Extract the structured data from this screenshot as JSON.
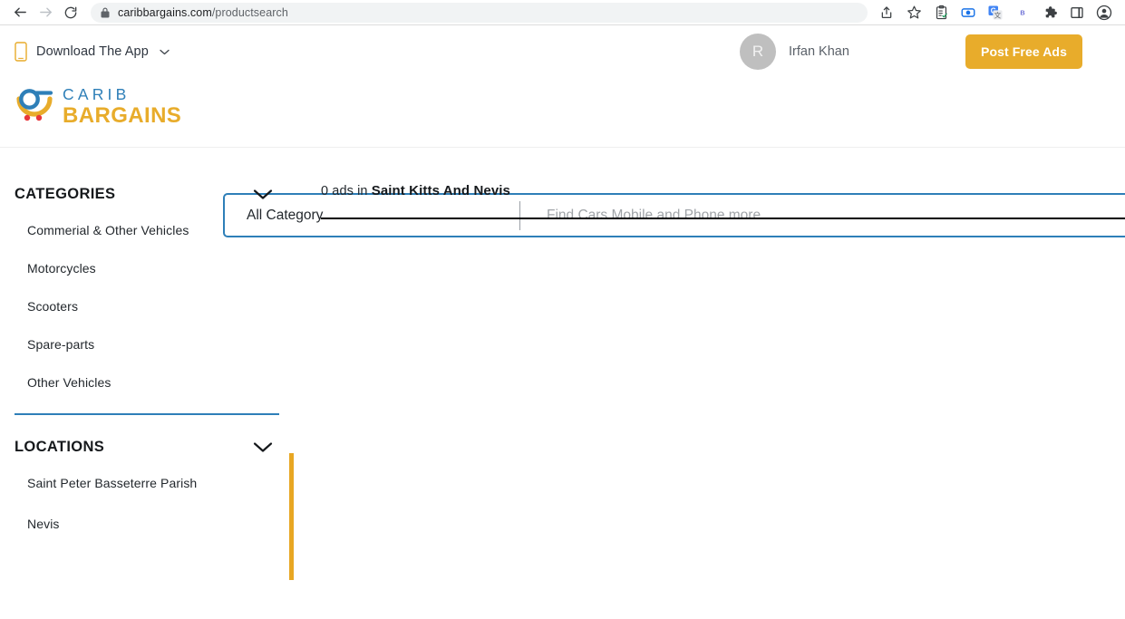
{
  "browser": {
    "back_icon": "back-arrow-icon",
    "forward_icon": "forward-arrow-icon",
    "reload_icon": "reload-icon",
    "lock_icon": "lock-icon",
    "url_domain": "caribbargains.com",
    "url_path": "/productsearch",
    "toolbar_icons": [
      {
        "name": "share-icon",
        "glyph": "share"
      },
      {
        "name": "bookmark-star-icon",
        "glyph": "star"
      },
      {
        "name": "clipboard-icon",
        "glyph": "clipboard"
      },
      {
        "name": "screen-recorder-icon",
        "glyph": "recorder"
      },
      {
        "name": "google-translate-icon",
        "glyph": "translate"
      },
      {
        "name": "bitwarden-icon",
        "glyph": "B"
      },
      {
        "name": "extensions-puzzle-icon",
        "glyph": "puzzle"
      },
      {
        "name": "side-panel-icon",
        "glyph": "panel"
      },
      {
        "name": "profile-avatar-icon",
        "glyph": "avatar"
      }
    ]
  },
  "header": {
    "download_app_label": "Download The App",
    "download_app_icon": "mobile-phone-icon",
    "download_app_caret": "chevron-down-icon",
    "avatar_initial": "R",
    "user_name": "Irfan Khan",
    "post_ads_label": "Post Free Ads",
    "accent_gold": "#e8ac2b",
    "accent_blue": "#2e7fb8"
  },
  "logo": {
    "top_word": "CARIB",
    "bottom_word": "BARGAINS",
    "mark_icon": "shopping-cart-logo-icon"
  },
  "search": {
    "category_value": "All Category",
    "category_caret": "chevron-down-icon",
    "placeholder": "Find Cars Mobile and Phone more..",
    "value": ""
  },
  "sidebar": {
    "categories": {
      "title": "CATEGORIES",
      "toggle_icon": "chevron-down-icon",
      "items": [
        {
          "label": "Commerial & Other Vehicles"
        },
        {
          "label": "Motorcycles"
        },
        {
          "label": "Scooters"
        },
        {
          "label": "Spare-parts"
        },
        {
          "label": "Other Vehicles"
        }
      ]
    },
    "locations": {
      "title": "LOCATIONS",
      "toggle_icon": "chevron-down-icon",
      "items": [
        {
          "label": "Saint Peter Basseterre Parish"
        },
        {
          "label": "Nevis"
        }
      ]
    },
    "scrollbar_color": "#e8a723"
  },
  "results": {
    "count_prefix": "0 ads in",
    "region": "Saint Kitts And Nevis"
  }
}
